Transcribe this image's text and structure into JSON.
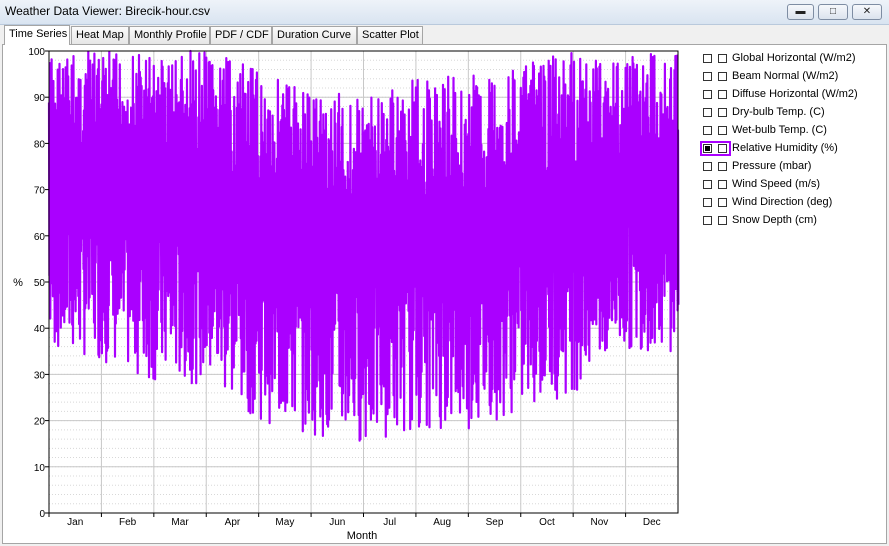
{
  "window": {
    "title": "Weather Data Viewer: Birecik-hour.csv"
  },
  "tabs": [
    {
      "label": "Time Series",
      "active": true
    },
    {
      "label": "Heat Map"
    },
    {
      "label": "Monthly Profile"
    },
    {
      "label": "PDF / CDF"
    },
    {
      "label": "Duration Curve"
    },
    {
      "label": "Scatter Plot"
    }
  ],
  "legend": [
    {
      "label": "Global Horizontal (W/m2)"
    },
    {
      "label": "Beam Normal (W/m2)"
    },
    {
      "label": "Diffuse Horizontal (W/m2)"
    },
    {
      "label": "Dry-bulb Temp. (C)"
    },
    {
      "label": "Wet-bulb Temp. (C)"
    },
    {
      "label": "Relative Humidity (%)",
      "checked": true
    },
    {
      "label": "Pressure (mbar)"
    },
    {
      "label": "Wind Speed (m/s)"
    },
    {
      "label": "Wind Direction (deg)"
    },
    {
      "label": "Snow Depth (cm)"
    }
  ],
  "chart_data": {
    "type": "line",
    "xlabel": "Month",
    "ylabel": "%",
    "ylim": [
      0,
      100
    ],
    "yticks": [
      0,
      10,
      20,
      30,
      40,
      50,
      60,
      70,
      80,
      90,
      100
    ],
    "categories": [
      "Jan",
      "Feb",
      "Mar",
      "Apr",
      "May",
      "Jun",
      "Jul",
      "Aug",
      "Sep",
      "Oct",
      "Nov",
      "Dec"
    ],
    "grid": true,
    "series_color": "#aa00ff",
    "series": [
      {
        "name": "Relative Humidity (%)",
        "monthly_envelope": {
          "min": [
            35,
            33,
            28,
            28,
            20,
            17,
            15,
            18,
            18,
            22,
            26,
            35
          ],
          "max": [
            100,
            100,
            100,
            100,
            96,
            93,
            90,
            94,
            95,
            97,
            100,
            100
          ]
        }
      }
    ]
  }
}
